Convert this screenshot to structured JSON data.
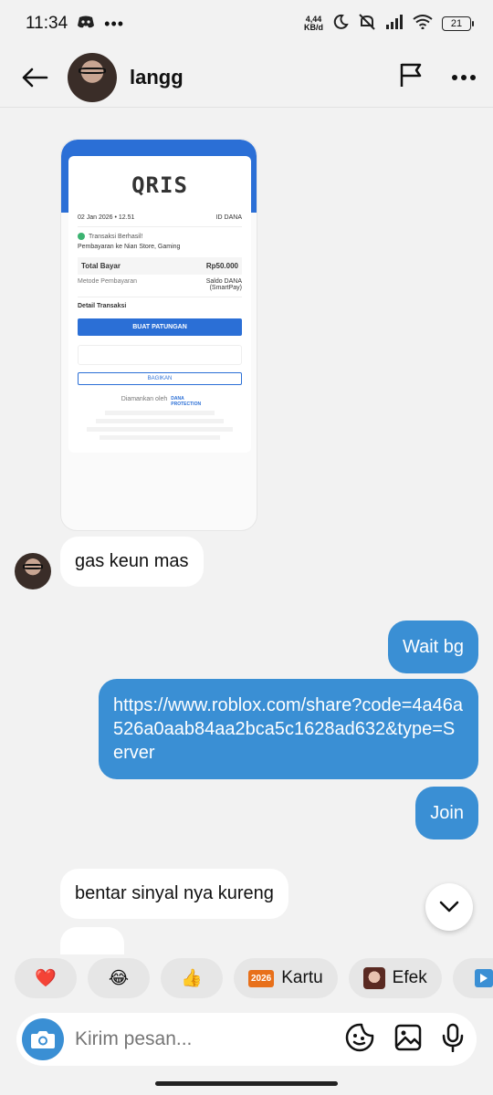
{
  "status_bar": {
    "time": "11:34",
    "net_speed_value": "4,44",
    "net_speed_unit": "KB/d",
    "battery": "21"
  },
  "header": {
    "contact_name": "langg"
  },
  "receipt": {
    "logo_text": "QRIS",
    "date": "02 Jan 2026 • 12.51",
    "id_label": "ID DANA",
    "status": "Transaksi Berhasil!",
    "merchant": "Pembayaran ke Nian Store, Gaming",
    "total_label": "Total Bayar",
    "total_value": "Rp50.000",
    "method_label": "Metode Pembayaran",
    "method_value": "Saldo DANA (SmartPay)",
    "detail_label": "Detail Transaksi",
    "patungan_button": "BUAT PATUNGAN",
    "share_button": "BAGIKAN",
    "secured_by": "Diamankan oleh",
    "protection": "DANA PROTECTION"
  },
  "messages": [
    {
      "direction": "in",
      "text": "gas keun mas"
    },
    {
      "direction": "out",
      "text": "Wait bg"
    },
    {
      "direction": "out",
      "text": "https://www.roblox.com/share?code=4a46a526a0aab84aa2bca5c1628ad632&type=Server"
    },
    {
      "direction": "out",
      "text": "Join"
    },
    {
      "direction": "in",
      "text": "bentar sinyal nya kureng"
    }
  ],
  "quick_replies": [
    {
      "label": "",
      "icon": "heart-emoji"
    },
    {
      "label": "",
      "icon": "joy-emoji"
    },
    {
      "label": "",
      "icon": "thumbs-up-emoji"
    },
    {
      "label": "Kartu",
      "icon": "2026-badge"
    },
    {
      "label": "Efek",
      "icon": "effect-thumbnail"
    },
    {
      "label": "",
      "icon": "play-icon"
    }
  ],
  "quick_reply_emojis": [
    "❤️",
    "😂",
    "👍"
  ],
  "badge_text": "2026",
  "composer": {
    "placeholder": "Kirim pesan..."
  },
  "colors": {
    "accent": "#3a8fd4",
    "background": "#f2f2f2"
  }
}
